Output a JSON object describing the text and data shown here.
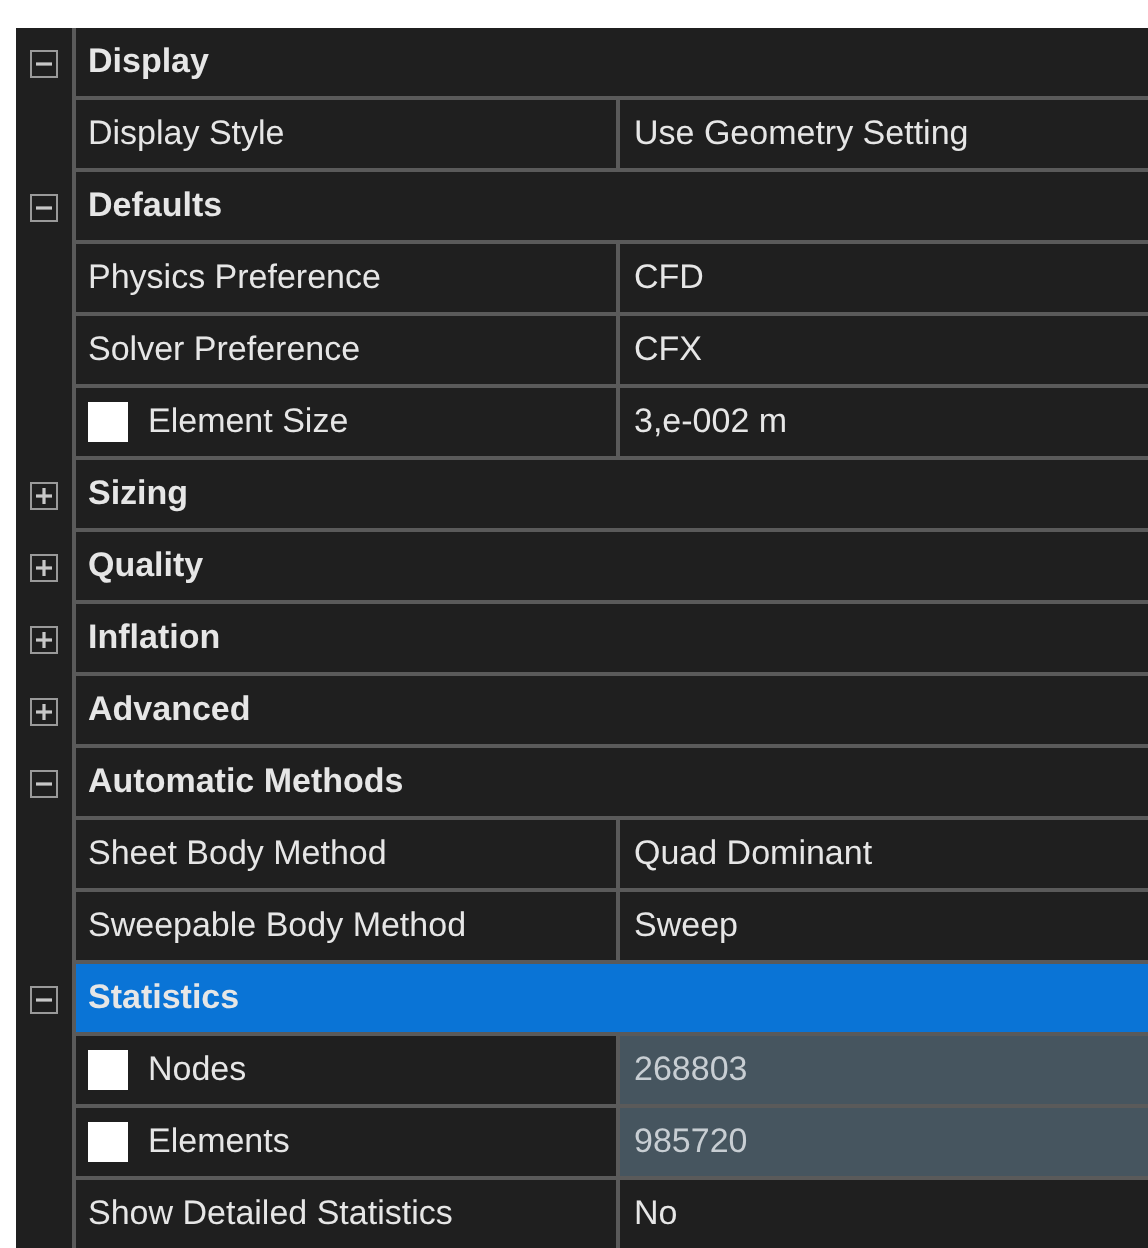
{
  "sections": [
    {
      "title": "Display",
      "expanded": true,
      "selected": false,
      "properties": [
        {
          "label": "Display Style",
          "value": "Use Geometry Setting",
          "readonly": false
        }
      ]
    },
    {
      "title": "Defaults",
      "expanded": true,
      "selected": false,
      "properties": [
        {
          "label": "Physics Preference",
          "value": "CFD",
          "readonly": false
        },
        {
          "label": "Solver Preference",
          "value": "CFX",
          "readonly": false
        },
        {
          "label": "Element Size",
          "value": "3,e-002 m",
          "readonly": false,
          "checked": false
        }
      ]
    },
    {
      "title": "Sizing",
      "expanded": false,
      "selected": false
    },
    {
      "title": "Quality",
      "expanded": false,
      "selected": false
    },
    {
      "title": "Inflation",
      "expanded": false,
      "selected": false
    },
    {
      "title": "Advanced",
      "expanded": false,
      "selected": false
    },
    {
      "title": "Automatic Methods",
      "expanded": true,
      "selected": false,
      "properties": [
        {
          "label": "Sheet Body Method",
          "value": "Quad Dominant",
          "readonly": false
        },
        {
          "label": "Sweepable Body Method",
          "value": "Sweep",
          "readonly": false
        }
      ]
    },
    {
      "title": "Statistics",
      "expanded": true,
      "selected": true,
      "properties": [
        {
          "label": "Nodes",
          "value": "268803",
          "readonly": true,
          "checked": false
        },
        {
          "label": "Elements",
          "value": "985720",
          "readonly": true,
          "checked": false
        },
        {
          "label": "Show Detailed Statistics",
          "value": "No",
          "readonly": false
        }
      ]
    }
  ]
}
